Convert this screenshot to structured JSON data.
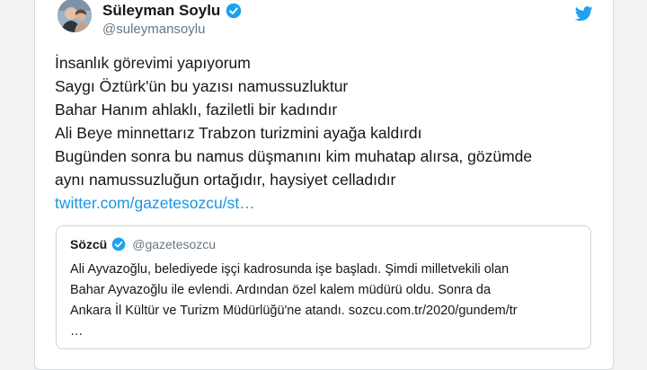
{
  "colors": {
    "brand": "#1da1f2",
    "link": "#1b95e0",
    "text": "#14171a",
    "muted": "#657786",
    "border": "#ccd6dd"
  },
  "author": {
    "name": "Süleyman Soylu",
    "handle": "@suleymansoylu",
    "verified": true,
    "verified_icon": "verified-badge-icon",
    "avatar_icon": "profile-photo"
  },
  "platform_icon": "twitter-bird-icon",
  "tweet": {
    "lines": [
      "İnsanlık görevimi yapıyorum",
      "Saygı Öztürk'ün bu yazısı namussuzluktur",
      "Bahar Hanım ahlaklı, faziletli bir kadındır",
      "Ali Beye minnettarız Trabzon turizmini ayağa kaldırdı",
      "Bugünden sonra bu namus düşmanını kim muhatap alırsa, gözümde",
      "aynı namussuzluğun ortağıdır, haysiyet celladıdır"
    ],
    "link": "twitter.com/gazetesozcu/st…"
  },
  "quoted_tweet": {
    "name": "Sözcü",
    "handle": "@gazetesozcu",
    "verified": true,
    "lines": [
      "Ali Ayvazoğlu, belediyede işçi kadrosunda işe başladı. Şimdi milletvekili olan",
      "Bahar Ayvazoğlu ile evlendi. Ardından özel kalem müdürü oldu. Sonra da",
      "Ankara İl Kültür ve Turizm Müdürlüğü'ne atandı. sozcu.com.tr/2020/gundem/tr",
      "…"
    ]
  }
}
